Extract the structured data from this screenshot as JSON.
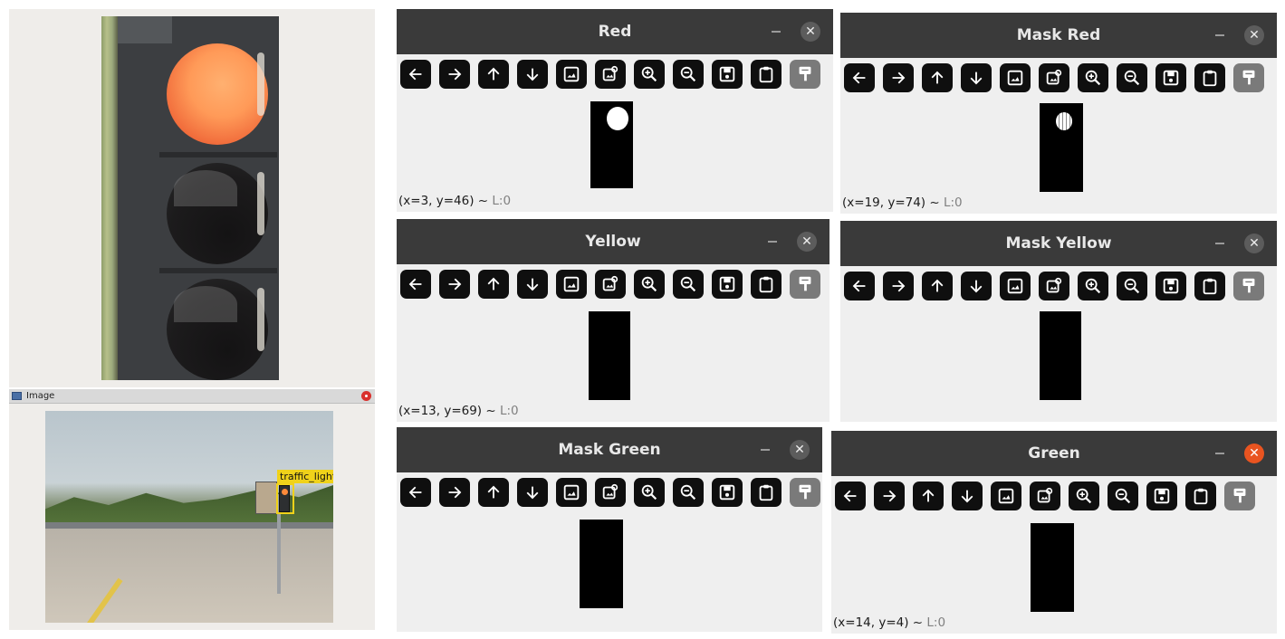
{
  "image_window": {
    "title": "Image",
    "detection_label": "traffic_light"
  },
  "toolbar_icons": [
    "arrow-left-icon",
    "arrow-right-icon",
    "arrow-up-icon",
    "arrow-down-icon",
    "image-icon",
    "image-settings-icon",
    "zoom-in-icon",
    "zoom-out-icon",
    "save-icon",
    "clipboard-icon",
    "properties-icon"
  ],
  "windows": {
    "red": {
      "title": "Red",
      "status_coords": "(x=3, y=46) ~",
      "status_level": "L:0"
    },
    "mask_red": {
      "title": "Mask Red",
      "status_coords": "(x=19, y=74) ~",
      "status_level": "L:0"
    },
    "yellow": {
      "title": "Yellow",
      "status_coords": "(x=13, y=69) ~",
      "status_level": "L:0"
    },
    "mask_yellow": {
      "title": "Mask Yellow",
      "status_coords": "",
      "status_level": ""
    },
    "mask_green": {
      "title": "Mask Green",
      "status_coords": "",
      "status_level": ""
    },
    "green": {
      "title": "Green",
      "status_coords": "(x=14, y=4) ~",
      "status_level": "L:0"
    }
  },
  "glyphs": {
    "close": "✕",
    "minimize": "–"
  },
  "colors": {
    "titlebar": "#3a3a3a",
    "close_active": "#e95420",
    "detection": "#f0d21a"
  }
}
